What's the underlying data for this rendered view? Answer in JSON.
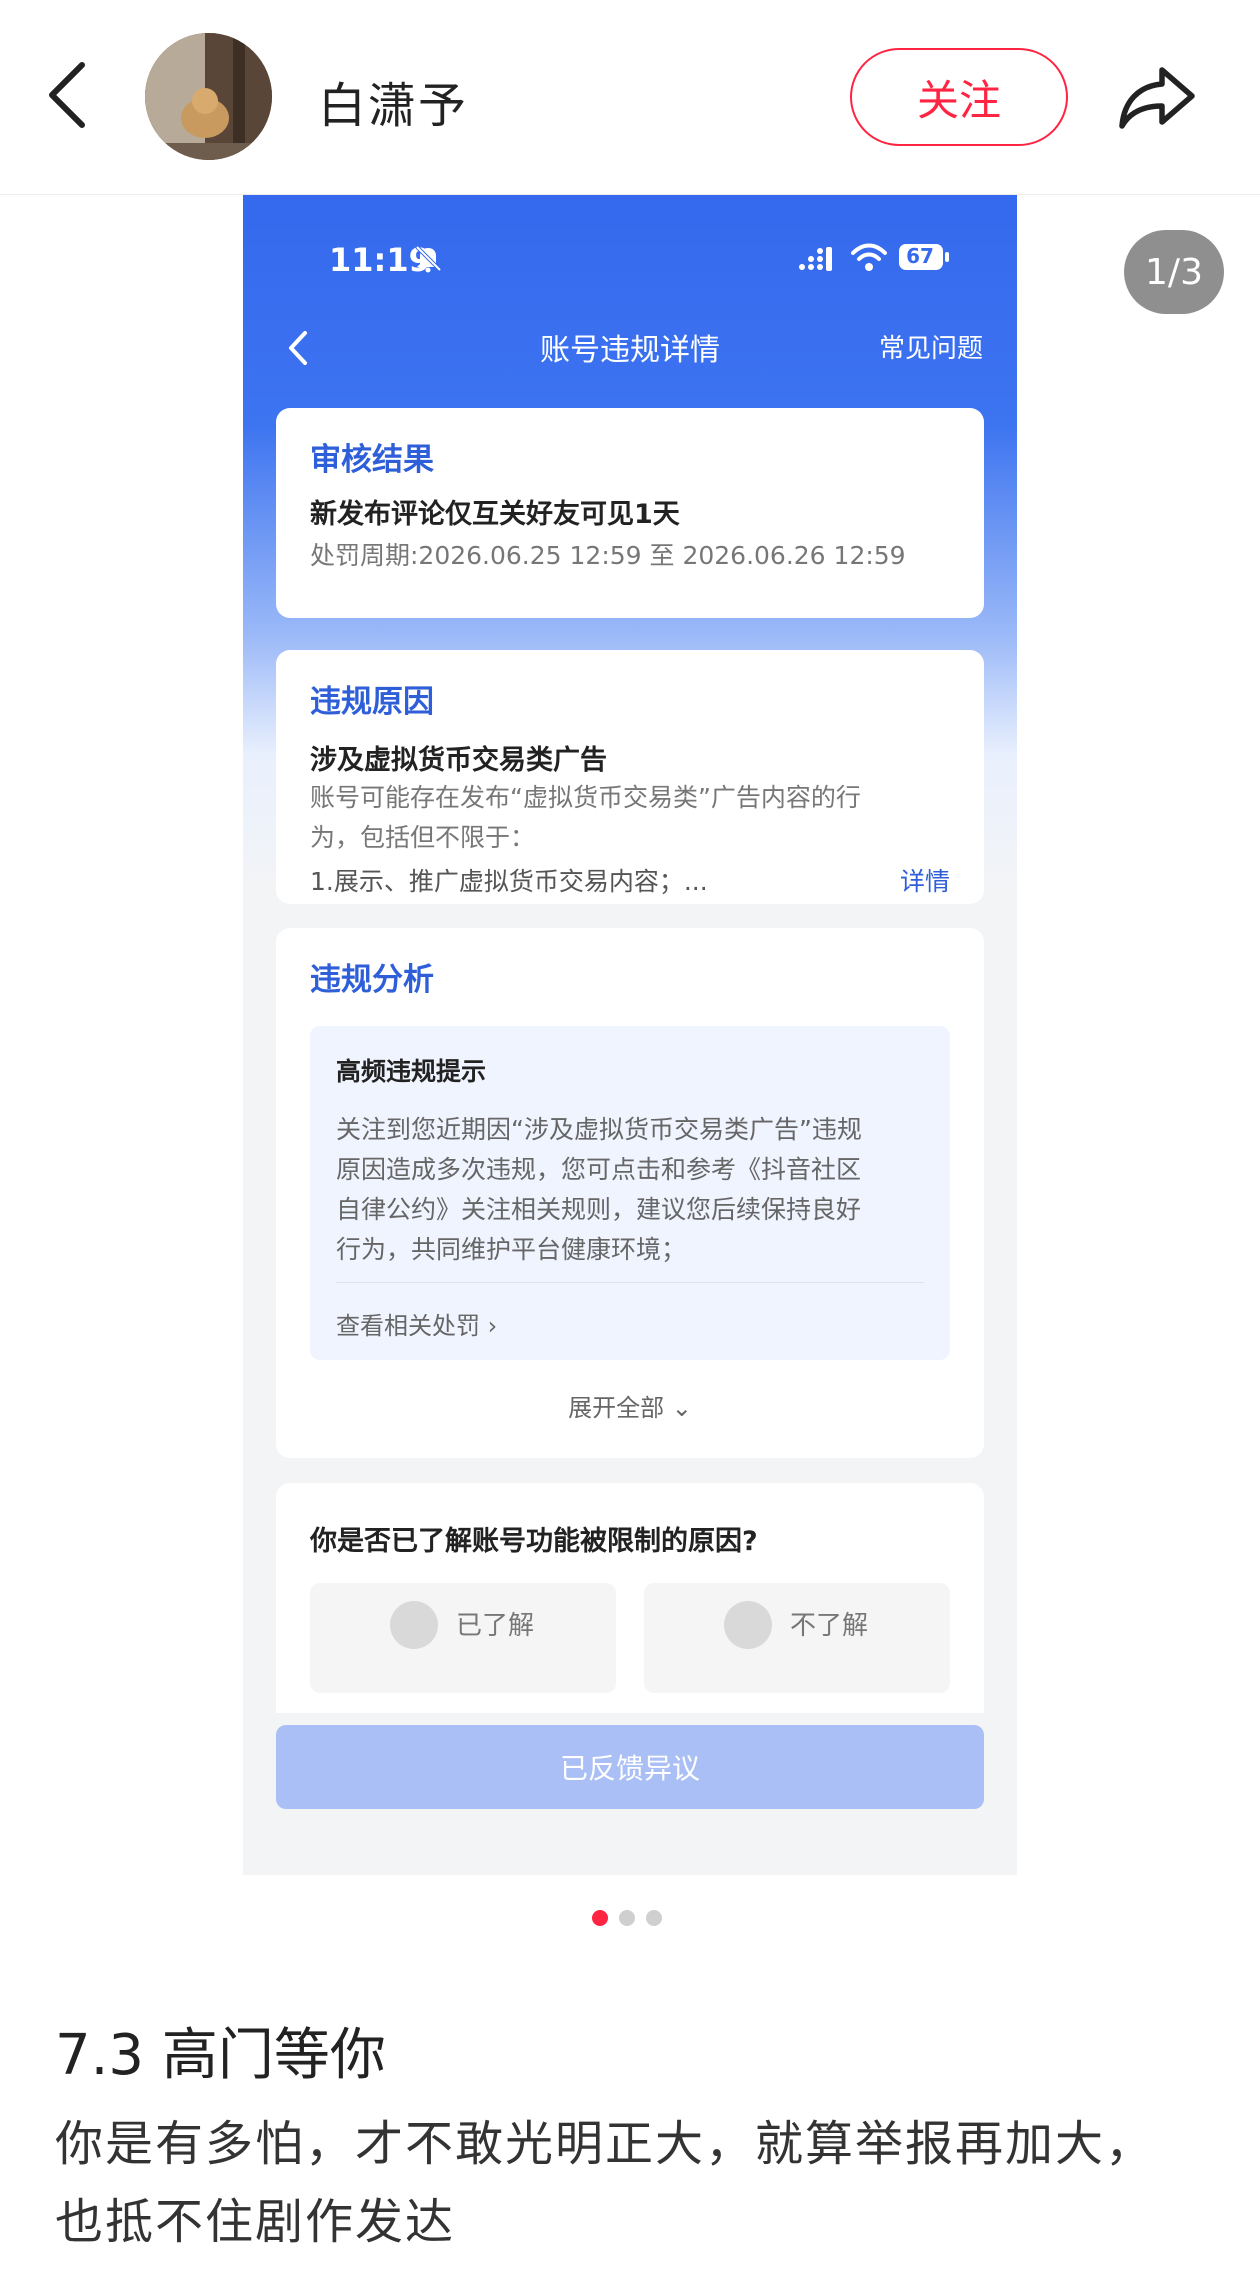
{
  "header": {
    "username": "白潇予",
    "follow_label": "关注",
    "icons": [
      "back-icon",
      "avatar",
      "share-icon"
    ]
  },
  "gallery": {
    "counter": "1/3",
    "current_index": 1,
    "total": 3
  },
  "screenshot": {
    "status_bar": {
      "time": "11:19",
      "battery": "67"
    },
    "nav": {
      "title": "账号违规详情",
      "faq": "常见问题"
    },
    "review_card": {
      "title": "审核结果",
      "result": "新发布评论仅互关好友可见1天",
      "period": "处罚周期:2026.06.25 12:59 至 2026.06.26 12:59"
    },
    "reason_card": {
      "title": "违规原因",
      "reason": "涉及虚拟货币交易类广告",
      "desc_line1": "账号可能存在发布“虚拟货币交易类”广告内容的行",
      "desc_line2": "为，包括但不限于：",
      "item1": "1.展示、推广虚拟货币交易内容；...",
      "detail_link": "详情"
    },
    "analysis_card": {
      "title": "违规分析",
      "hint_title": "高频违规提示",
      "hint_line1": "关注到您近期因“涉及虚拟货币交易类广告”违规",
      "hint_line2": "原因造成多次违规，您可点击和参考《抖音社区",
      "hint_line3": "自律公约》关注相关规则，建议您后续保持良好",
      "hint_line4": "行为，共同维护平台健康环境；",
      "related_link": "查看相关处罚 ›",
      "expand_all": "展开全部 ⌄"
    },
    "survey_card": {
      "question": "你是否已了解账号功能被限制的原因?",
      "option_yes": "已了解",
      "option_no": "不了解"
    },
    "feedback_button": "已反馈异议",
    "colors": {
      "accent": "#2f5fd8",
      "header_blue": "#3569ee"
    }
  },
  "post": {
    "title": "7.3 高门等你",
    "body": "你是有多怕，才不敢光明正大，就算举报再加大，也抵不住剧作发达"
  },
  "colors": {
    "brand_red": "#ff2442",
    "active_dot": "#ff2442"
  }
}
